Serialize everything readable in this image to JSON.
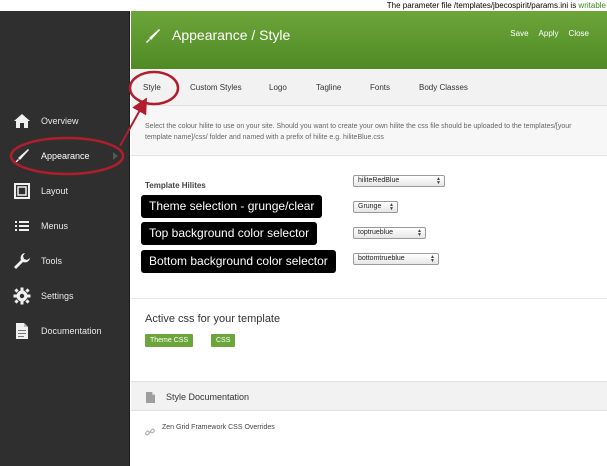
{
  "notice": {
    "text": "The parameter file /templates/jbecospirit/params.ini is ",
    "status": "writable"
  },
  "sidebar": {
    "items": [
      {
        "label": "Overview",
        "icon": "home-icon"
      },
      {
        "label": "Appearance",
        "icon": "brush-icon"
      },
      {
        "label": "Layout",
        "icon": "layout-icon"
      },
      {
        "label": "Menus",
        "icon": "list-icon"
      },
      {
        "label": "Tools",
        "icon": "wrench-icon"
      },
      {
        "label": "Settings",
        "icon": "gear-icon"
      },
      {
        "label": "Documentation",
        "icon": "document-icon"
      }
    ]
  },
  "header": {
    "title": "Appearance / Style",
    "save": "Save",
    "apply": "Apply",
    "close": "Close"
  },
  "tabs": [
    "Style",
    "Custom Styles",
    "Logo",
    "Tagline",
    "Fonts",
    "Body Classes"
  ],
  "description": "Select the colour hilite to use on your site. Should you want to create your own hilite the css file should be uploaded to the templates/[your template name]/css/ folder and named with a prefix of hilite e.g. hiliteBlue.css",
  "template_hilites": {
    "label": "Template Hilites",
    "hilite_select": "hiliteRedBlue",
    "theme_select": "Grunge",
    "top_select": "toptrueblue",
    "bottom_select": "bottomtrueblue"
  },
  "callouts": {
    "theme": "Theme selection - grunge/clear",
    "top": "Top background color selector",
    "bottom": "Bottom background color selector"
  },
  "active_css": {
    "title": "Active css for your template",
    "theme_btn": "Theme CSS",
    "css_btn": "CSS"
  },
  "style_doc": {
    "title": "Style Documentation",
    "link": "Zen Grid Framework CSS Overrides"
  },
  "colors": {
    "accent_green": "#5a9a2c",
    "sidebar": "#2f2f2f",
    "annotation_red": "#b01e2e"
  }
}
